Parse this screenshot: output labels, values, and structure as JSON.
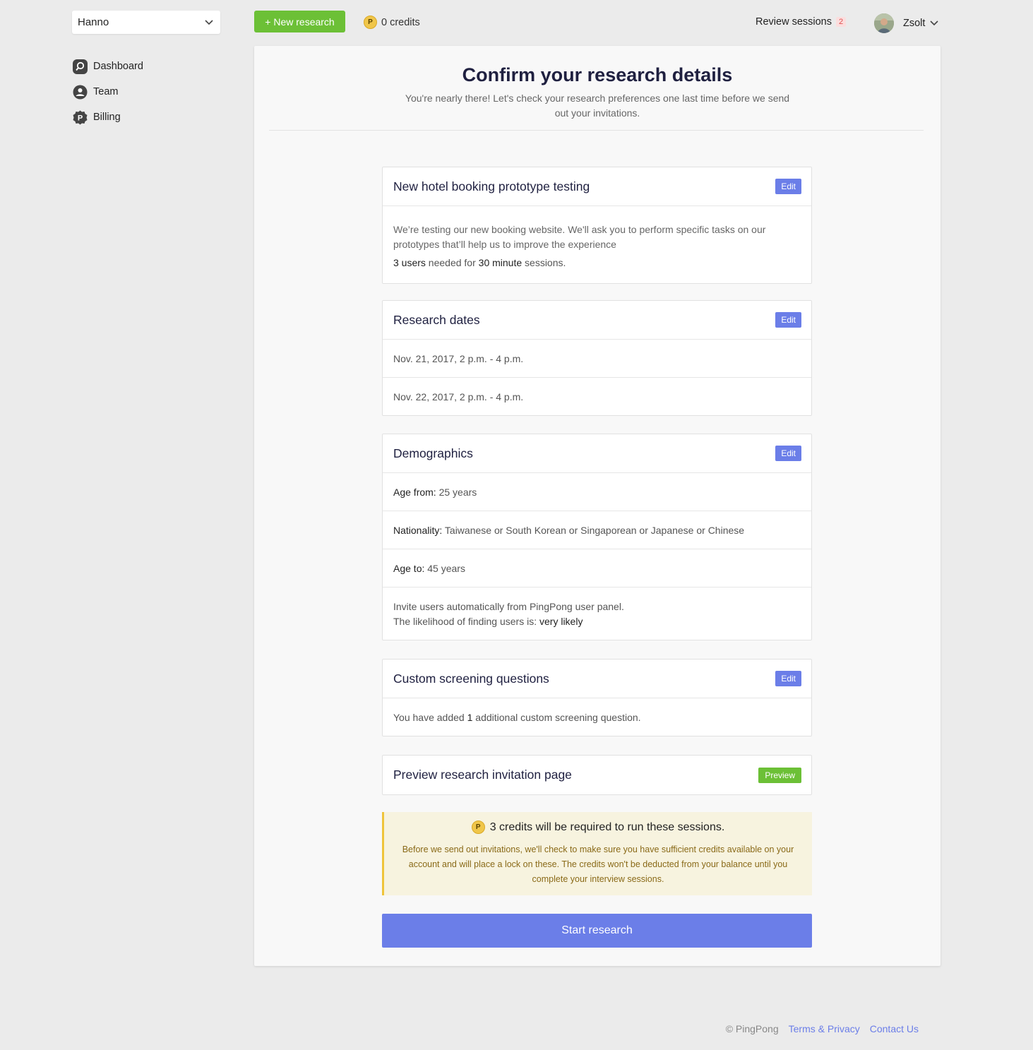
{
  "sidebar": {
    "org": "Hanno",
    "items": [
      {
        "label": "Dashboard",
        "icon": "search-icon"
      },
      {
        "label": "Team",
        "icon": "user-circle-icon"
      },
      {
        "label": "Billing",
        "icon": "billing-badge-icon"
      }
    ]
  },
  "topbar": {
    "new_research": "+ New research",
    "credits_coin": "P",
    "credits": "0 credits",
    "review_sessions": "Review sessions",
    "review_count": "2",
    "user_name": "Zsolt"
  },
  "main": {
    "title": "Confirm your research details",
    "subtitle": "You're nearly there! Let's check your research preferences one last time before we send out your invitations.",
    "research": {
      "title": "New hotel booking prototype testing",
      "edit": "Edit",
      "description": "We’re testing our new booking website. We'll ask you to perform specific tasks on our prototypes that’ll help us to improve the experience",
      "users": "3 users",
      "needed_for": " needed for ",
      "duration": "30 minute",
      "sessions": " sessions."
    },
    "dates": {
      "title": "Research dates",
      "edit": "Edit",
      "items": [
        "Nov. 21, 2017, 2 p.m. - 4 p.m.",
        "Nov. 22, 2017, 2 p.m. - 4 p.m."
      ]
    },
    "demographics": {
      "title": "Demographics",
      "edit": "Edit",
      "age_from_label": "Age from:",
      "age_from": " 25 years",
      "nationality_label": "Nationality:",
      "nationality": " Taiwanese or South Korean or Singaporean or Japanese or Chinese",
      "age_to_label": "Age to:",
      "age_to": " 45 years",
      "invite_line": "Invite users automatically from PingPong user panel.",
      "likelihood_label": "The likelihood of finding users is: ",
      "likelihood": "very likely"
    },
    "screening": {
      "title": "Custom screening questions",
      "edit": "Edit",
      "text_before": "You have added ",
      "count": "1",
      "text_after": " additional custom screening question."
    },
    "preview": {
      "title": "Preview research invitation page",
      "button": "Preview"
    },
    "notice": {
      "coin": "P",
      "title": "3 credits will be required to run these sessions.",
      "body": "Before we send out invitations, we'll check to make sure you have sufficient credits available on your account and will place a lock on these. The credits won't be deducted from your balance until you complete your interview sessions."
    },
    "start_button": "Start research"
  },
  "footer": {
    "copyright": "© PingPong",
    "terms": "Terms & Privacy",
    "contact": "Contact Us"
  },
  "colors": {
    "primary": "#6b7ee8",
    "success": "#6cc036",
    "coin": "#f0c64a",
    "notice_bg": "#f7f3df",
    "notice_border": "#efc43a",
    "badge_text": "#e04f4f"
  }
}
